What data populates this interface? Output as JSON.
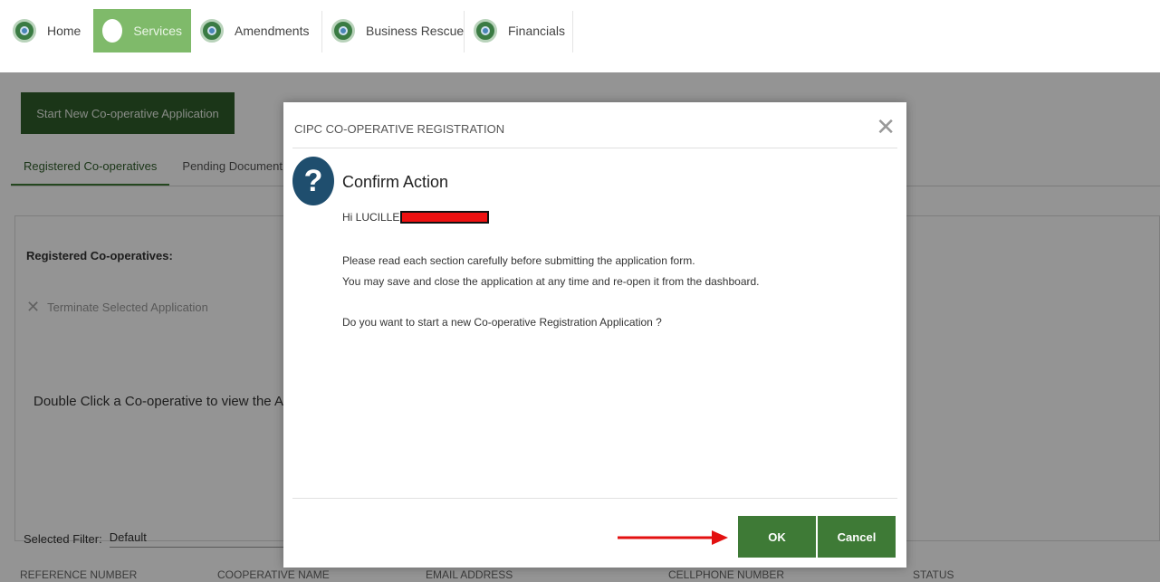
{
  "nav": {
    "items": [
      {
        "label": "Home",
        "icon": "globe-icon",
        "active": false
      },
      {
        "label": "Services",
        "icon": "circle-icon",
        "active": true
      },
      {
        "label": "Amendments",
        "icon": "globe-icon",
        "active": false
      },
      {
        "label": "Business Rescue",
        "icon": "globe-icon",
        "active": false
      },
      {
        "label": "Financials",
        "icon": "globe-icon",
        "active": false
      }
    ]
  },
  "page": {
    "start_button": "Start New Co-operative Application",
    "tabs": [
      "Registered Co-operatives",
      "Pending Document U"
    ],
    "panel_title": "Registered Co-operatives:",
    "terminate": "Terminate Selected Application",
    "hint": "Double Click a Co-operative to view the App",
    "filter_label": "Selected Filter:",
    "filter_value": "Default",
    "columns": [
      "REFERENCE NUMBER",
      "COOPERATIVE NAME",
      "EMAIL ADDRESS",
      "CELLPHONE NUMBER",
      "STATUS"
    ]
  },
  "modal": {
    "title": "CIPC CO-OPERATIVE REGISTRATION",
    "close_glyph": "✕",
    "heading": "Confirm Action",
    "greeting": "Hi LUCILLE",
    "line1": "Please read each section carefully before submitting the application form.",
    "line2": "You may save and close the application at any time and re-open it from the dashboard.",
    "question": "Do you want to start a new Co-operative Registration Application ?",
    "ok": "OK",
    "cancel": "Cancel"
  },
  "colors": {
    "accent_green": "#3e7a36",
    "active_nav": "#7fba6a",
    "annotation_red": "#e31010"
  }
}
